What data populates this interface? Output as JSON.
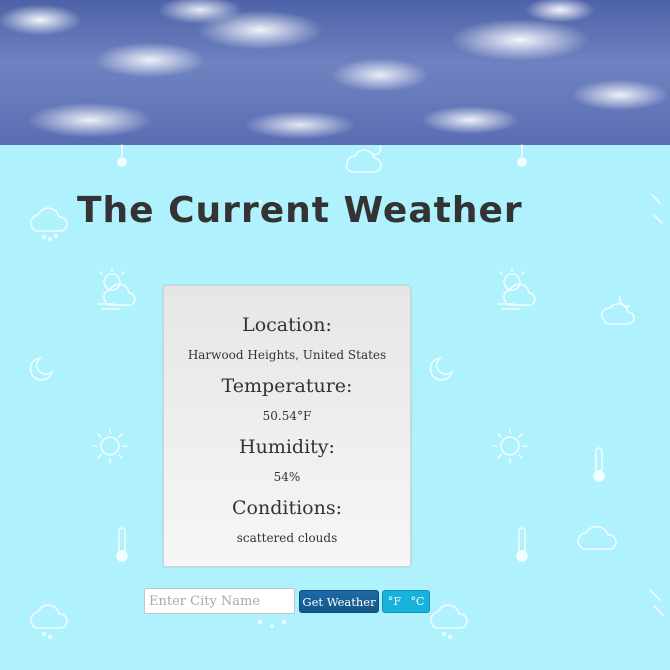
{
  "header": {
    "title": "The Current Weather"
  },
  "weather": {
    "location_label": "Location:",
    "location_value": "Harwood Heights, United States",
    "temperature_label": "Temperature:",
    "temperature_value": "50.54°F",
    "humidity_label": "Humidity:",
    "humidity_value": "54%",
    "conditions_label": "Conditions:",
    "conditions_value": "scattered clouds"
  },
  "search": {
    "placeholder": "Enter City Name",
    "value": "",
    "button_label": "Get Weather"
  },
  "units": {
    "fahrenheit_label": "°F",
    "celsius_label": "°C"
  },
  "colors": {
    "background": "#aff2fd",
    "title": "#333333",
    "button_primary": "#14578a",
    "button_unit": "#18b3dc"
  },
  "icons": {
    "hero": "cloudy-sky-photo",
    "background_pattern": [
      "thermometer-icon",
      "cloud-icon",
      "cloud-snow-icon",
      "sun-icon",
      "sun-cloud-wind-icon",
      "moon-icon",
      "moon-cloud-icon",
      "cloud-rain-icon"
    ]
  }
}
